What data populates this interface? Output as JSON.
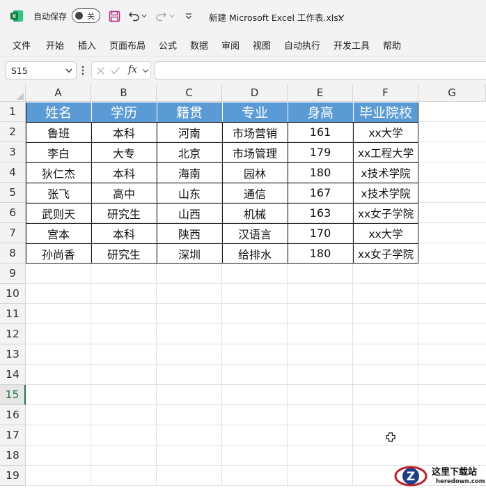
{
  "titlebar": {
    "autosave_label": "自动保存",
    "autosave_state": "关",
    "file_title": "新建 Microsoft Excel 工作表.xlsx",
    "icons": [
      "excel-logo-icon",
      "save-icon",
      "undo-icon",
      "redo-icon",
      "customize-quick-access-icon",
      "title-dropdown-icon"
    ]
  },
  "ribbon": {
    "tabs": [
      "文件",
      "开始",
      "插入",
      "页面布局",
      "公式",
      "数据",
      "审阅",
      "视图",
      "自动执行",
      "开发工具",
      "帮助"
    ]
  },
  "formula_bar": {
    "name_box": "S15",
    "fx_label": "fx",
    "formula_value": ""
  },
  "grid": {
    "columns": [
      "A",
      "B",
      "C",
      "D",
      "E",
      "F",
      "G"
    ],
    "rows": [
      "1",
      "2",
      "3",
      "4",
      "5",
      "6",
      "7",
      "8",
      "9",
      "10",
      "11",
      "12",
      "13",
      "14",
      "15",
      "16",
      "17",
      "18",
      "19"
    ],
    "active_row": "15"
  },
  "table": {
    "headers": [
      "姓名",
      "学历",
      "籍贯",
      "专业",
      "身高",
      "毕业院校"
    ],
    "rows": [
      [
        "鲁班",
        "本科",
        "河南",
        "市场营销",
        "161",
        "xx大学"
      ],
      [
        "李白",
        "大专",
        "北京",
        "市场管理",
        "179",
        "xx工程大学"
      ],
      [
        "狄仁杰",
        "本科",
        "海南",
        "园林",
        "180",
        "x技术学院"
      ],
      [
        "张飞",
        "高中",
        "山东",
        "通信",
        "167",
        "x技术学院"
      ],
      [
        "武则天",
        "研究生",
        "山西",
        "机械",
        "163",
        "xx女子学院"
      ],
      [
        "宫本",
        "本科",
        "陕西",
        "汉语言",
        "170",
        "xx大学"
      ],
      [
        "孙尚香",
        "研究生",
        "深圳",
        "给排水",
        "180",
        "xx女子学院"
      ]
    ]
  },
  "colors": {
    "header_fill": "#5b9bd5",
    "excel_green": "#217346",
    "chrome": "#f3f3f3",
    "save_icon": "#b03a8a"
  },
  "watermark": {
    "brand": "这里下载站",
    "domain": "heredown.com",
    "logo_letter": "Z"
  }
}
